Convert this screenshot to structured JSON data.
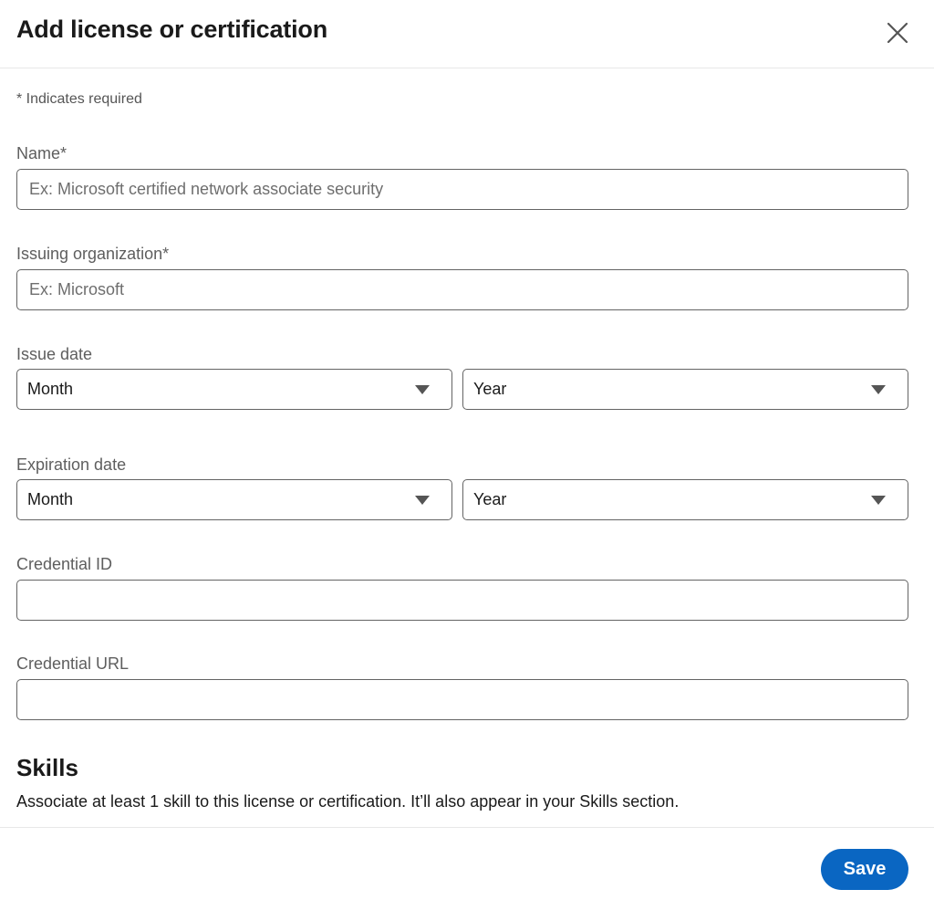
{
  "dialog": {
    "title": "Add license or certification",
    "close_icon": "close-icon"
  },
  "form": {
    "required_note": "* Indicates required",
    "name": {
      "label": "Name*",
      "value": "",
      "placeholder": "Ex: Microsoft certified network associate security"
    },
    "issuing_organization": {
      "label": "Issuing organization*",
      "value": "",
      "placeholder": "Ex: Microsoft"
    },
    "issue_date": {
      "label": "Issue date",
      "month": "Month",
      "year": "Year"
    },
    "expiration_date": {
      "label": "Expiration date",
      "month": "Month",
      "year": "Year"
    },
    "credential_id": {
      "label": "Credential ID",
      "value": ""
    },
    "credential_url": {
      "label": "Credential URL",
      "value": ""
    }
  },
  "skills": {
    "heading": "Skills",
    "description": "Associate at least 1 skill to this license or certification. It’ll also appear in your Skills section."
  },
  "footer": {
    "save_label": "Save"
  },
  "colors": {
    "primary": "#0a66c2",
    "border": "#646464",
    "text": "#1a1a1a",
    "muted": "#5e5e5e"
  }
}
